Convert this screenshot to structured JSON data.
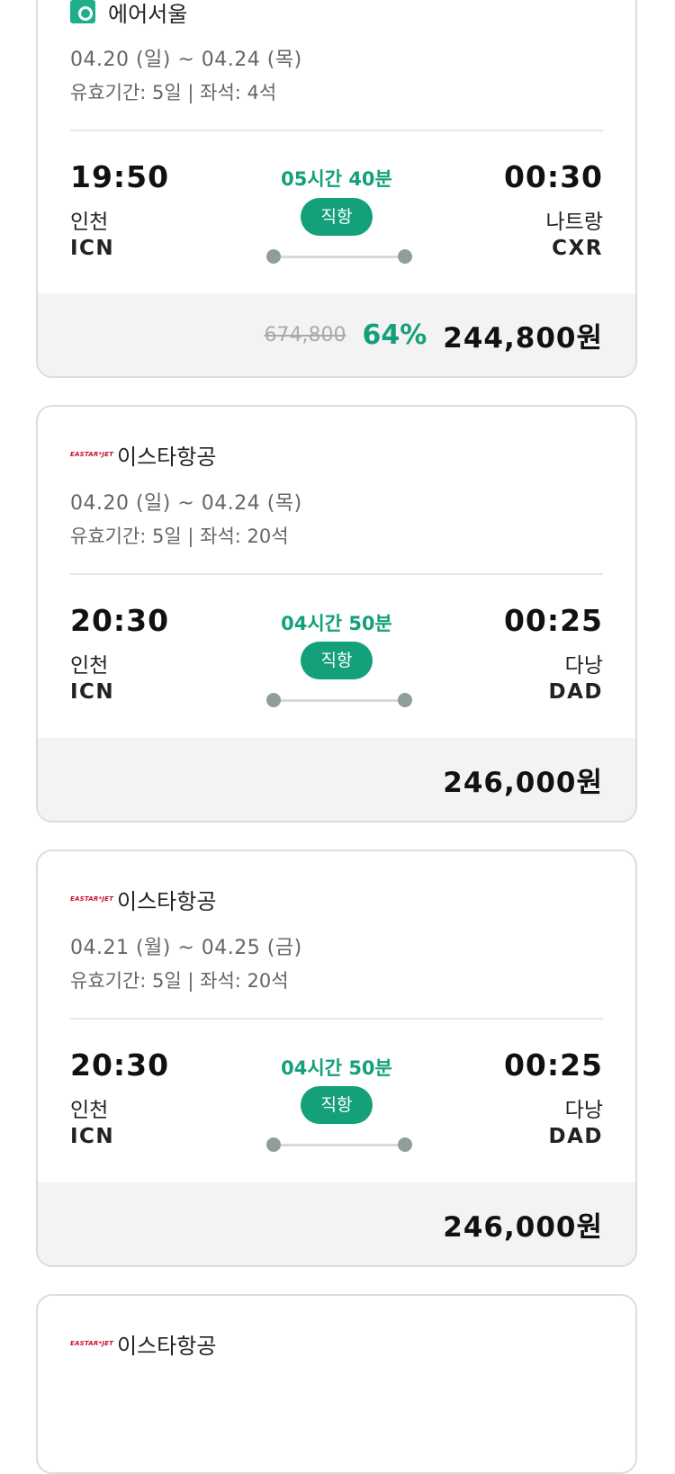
{
  "flights": [
    {
      "airline": "에어서울",
      "logo": "airseoul-logo",
      "date": "04.20 (일) ~ 04.24 (목)",
      "validity": "유효기간: 5일 | 좌석: 4석",
      "dep_time": "19:50",
      "dep_city": "인천",
      "dep_code": "ICN",
      "duration": "05시간 40분",
      "type": "직항",
      "arr_time": "00:30",
      "arr_city": "나트랑",
      "arr_code": "CXR",
      "original_price": "674,800",
      "discount": "64%",
      "price": "244,800원"
    },
    {
      "airline": "이스타항공",
      "logo_text": "EASTAR*JET",
      "date": "04.20 (일) ~ 04.24 (목)",
      "validity": "유효기간: 5일 | 좌석: 20석",
      "dep_time": "20:30",
      "dep_city": "인천",
      "dep_code": "ICN",
      "duration": "04시간 50분",
      "type": "직항",
      "arr_time": "00:25",
      "arr_city": "다낭",
      "arr_code": "DAD",
      "price": "246,000원"
    },
    {
      "airline": "이스타항공",
      "logo_text": "EASTAR*JET",
      "date": "04.21 (월) ~ 04.25 (금)",
      "validity": "유효기간: 5일 | 좌석: 20석",
      "dep_time": "20:30",
      "dep_city": "인천",
      "dep_code": "ICN",
      "duration": "04시간 50분",
      "type": "직항",
      "arr_time": "00:25",
      "arr_city": "다낭",
      "arr_code": "DAD",
      "price": "246,000원"
    },
    {
      "airline": "이스타항공",
      "logo_text": "EASTAR*JET"
    }
  ],
  "colors": {
    "accent": "#13a07a",
    "price_bg": "#f3f3f3"
  }
}
